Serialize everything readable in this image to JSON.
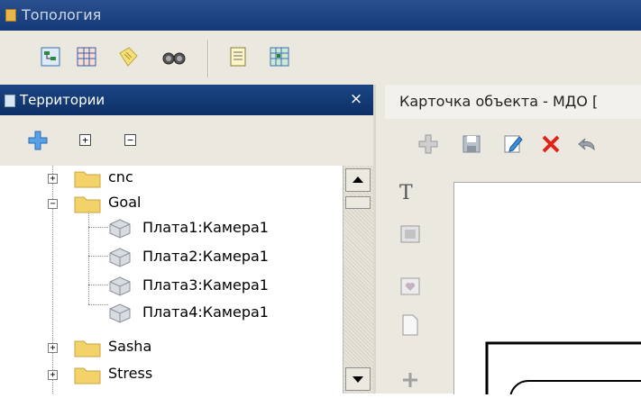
{
  "window": {
    "title": "Топология"
  },
  "toolbar": {
    "buttons": [
      {
        "name": "topology-tree-icon"
      },
      {
        "name": "grid-table-icon"
      },
      {
        "name": "notes-icon"
      },
      {
        "name": "binoculars-icon"
      },
      {
        "name": "document-icon"
      },
      {
        "name": "map-grid-icon"
      }
    ]
  },
  "left_panel": {
    "title": "Территории",
    "close_glyph": "×",
    "tools": {
      "expand_glyph": "+",
      "collapse_glyph": "−"
    },
    "tree": [
      {
        "label": "cnc",
        "type": "folder",
        "expander": "+",
        "children": []
      },
      {
        "label": "Goal",
        "type": "folder",
        "expander": "−",
        "children": [
          {
            "label": "Плата1:Камера1",
            "type": "camera"
          },
          {
            "label": "Плата2:Камера1",
            "type": "camera"
          },
          {
            "label": "Плата3:Камера1",
            "type": "camera"
          },
          {
            "label": "Плата4:Камера1",
            "type": "camera"
          }
        ]
      },
      {
        "label": "Sasha",
        "type": "folder",
        "expander": "+",
        "children": []
      },
      {
        "label": "Stress",
        "type": "folder",
        "expander": "+",
        "children": []
      }
    ]
  },
  "right_panel": {
    "title": "Карточка объекта - МДО [",
    "toolbar": [
      "add-icon",
      "save-icon",
      "edit-icon",
      "delete-icon",
      "undo-icon"
    ],
    "side_tools": [
      "text-tool-icon",
      "image-tool-icon",
      "shape-tool-icon",
      "page-tool-icon",
      "move-tool-icon"
    ],
    "text_tool_glyph": "T"
  },
  "colors": {
    "titlebar": "#1f4585",
    "panel_header": "#153d7a",
    "folder": "#f3d26a",
    "delete": "#e0231a"
  }
}
